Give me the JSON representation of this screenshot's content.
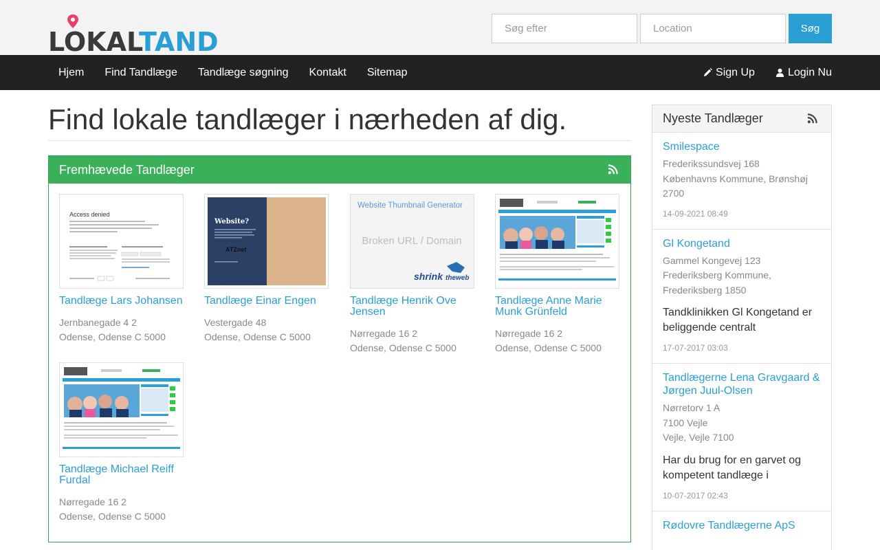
{
  "header": {
    "logo_part1": "LOKAL",
    "logo_part2": "TAND",
    "search_what_placeholder": "Søg efter",
    "search_where_placeholder": "Location",
    "search_button": "Søg"
  },
  "nav": {
    "items": [
      {
        "label": "Hjem"
      },
      {
        "label": "Find Tandlæge"
      },
      {
        "label": "Tandlæge søgning"
      },
      {
        "label": "Kontakt"
      },
      {
        "label": "Sitemap"
      }
    ],
    "signup": "Sign Up",
    "login": "Login Nu"
  },
  "main": {
    "title": "Find lokale tandlæger i nærheden af dig.",
    "featured": {
      "heading": "Fremhævede Tandlæger",
      "cards": [
        {
          "title": "Tandlæge Lars Johansen",
          "address1": "Jernbanegade 4 2",
          "address2": "Odense, Odense C 5000",
          "thumb": "access-denied"
        },
        {
          "title": "Tandlæge Einar Engen",
          "address1": "Vestergade 48",
          "address2": "Odense, Odense C 5000",
          "thumb": "website-placeholder"
        },
        {
          "title": "Tandlæge Henrik Ove Jensen",
          "address1": "Nørregade 16 2",
          "address2": "Odense, Odense C 5000",
          "thumb": "broken-url"
        },
        {
          "title": "Tandlæge Anne Marie Munk Grünfeld",
          "address1": "Nørregade 16 2",
          "address2": "Odense, Odense C 5000",
          "thumb": "clinic-site"
        },
        {
          "title": "Tandlæge Michael Reiff Furdal",
          "address1": "Nørregade 16 2",
          "address2": "Odense, Odense C 5000",
          "thumb": "clinic-site"
        }
      ],
      "thumb_texts": {
        "access_denied": "Access denied",
        "website": "Website?",
        "atz": "ATZnet",
        "generator": "Website Thumbnail Generator",
        "broken": "Broken URL / Domain",
        "shrink": "shrink",
        "theweb": "theweb"
      }
    }
  },
  "sidebar": {
    "heading": "Nyeste Tandlæger",
    "items": [
      {
        "title": "Smilespace",
        "address": [
          "Frederikssundsvej 168",
          "Københavns Kommune, Brønshøj",
          "2700"
        ],
        "desc": "",
        "date": "14-09-2021 08:49"
      },
      {
        "title": "Gl Kongetand",
        "address": [
          "Gammel Kongevej 123",
          "Frederiksberg Kommune,",
          "Frederiksberg 1850"
        ],
        "desc": "Tandklinikken Gl Kongetand er beliggende centralt",
        "date": "17-07-2017 03:03"
      },
      {
        "title": "Tandlægerne Lena Gravgaard & Jørgen Juul-Olsen",
        "address": [
          "Nørretorv 1 A",
          "7100 Vejle",
          "Vejle, Vejle 7100"
        ],
        "desc": "Har du brug for en garvet og kompetent tandlæge i",
        "date": "10-07-2017 02:43"
      },
      {
        "title": "Rødovre Tandlægerne ApS",
        "address": [],
        "desc": "",
        "date": ""
      }
    ]
  },
  "colors": {
    "accent": "#2a9fd6",
    "navbar": "#222222",
    "panel_green": "#3bb05a"
  }
}
